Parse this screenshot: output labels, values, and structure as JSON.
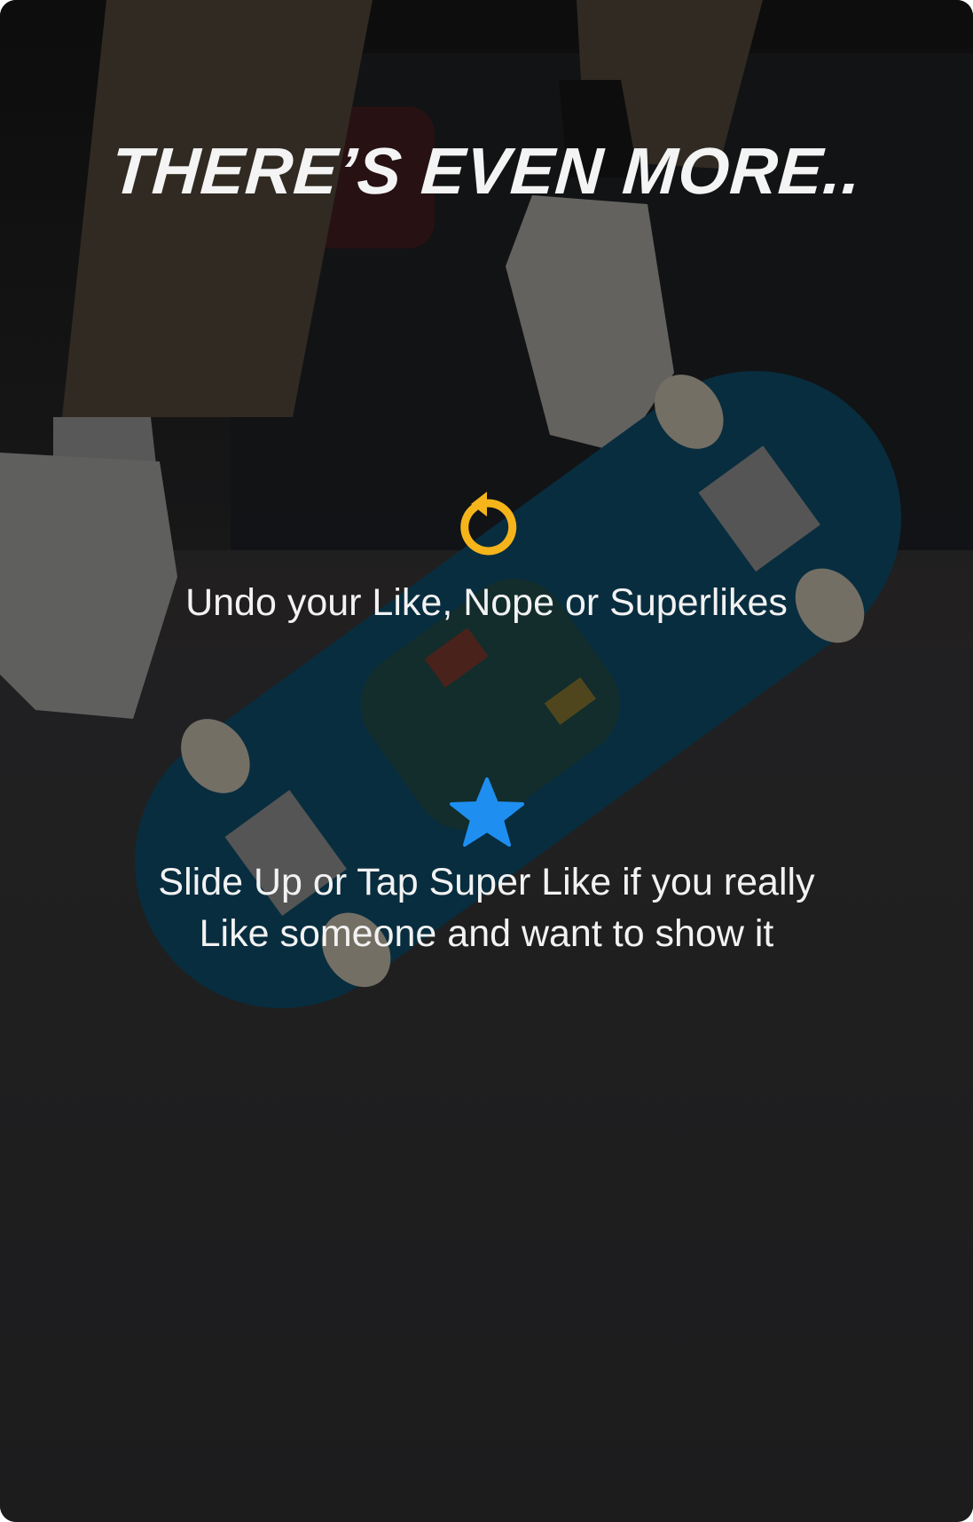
{
  "header": {
    "title": "THERE’S EVEN MORE.."
  },
  "features": [
    {
      "icon": "undo-icon",
      "color": "#F5B51A",
      "text": "Undo your Like, Nope or Superlikes"
    },
    {
      "icon": "star-icon",
      "color": "#1E8FF0",
      "text": "Slide Up or Tap Super Like if you really\nLike someone and want to show it"
    }
  ],
  "colors": {
    "overlay": "#000000",
    "text": "#F2F2F2",
    "board": "#0E4A66"
  }
}
